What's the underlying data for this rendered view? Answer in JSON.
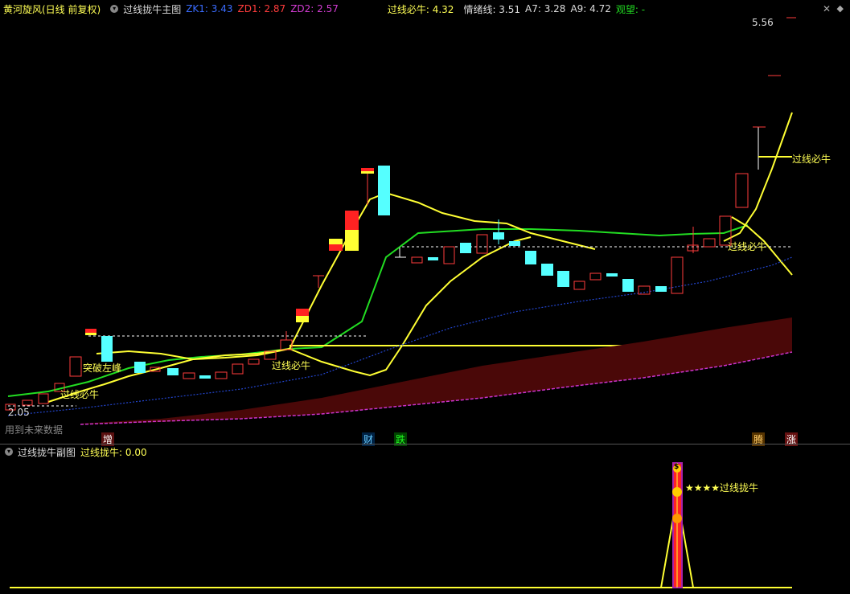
{
  "header": {
    "stock_name": "黄河旋风(日线 前复权)",
    "indicator_name": "过线拢牛主图",
    "zk1_label": "ZK1: 3.43",
    "zd1_label": "ZD1: 2.87",
    "zd2_label": "ZD2: 2.57",
    "guoxian_label": "过线必牛: 4.32",
    "qingxu_label": "情绪线: 3.51",
    "a7_label": "A7: 3.28",
    "a9_label": "A9: 4.72",
    "guanwang_label": "观望: -",
    "colors": {
      "zk1": "#3a6cff",
      "zd1": "#ff3c3c",
      "zd2": "#d23cd2",
      "yellow": "#ffff55",
      "green": "#22dd22",
      "white": "#dddddd"
    }
  },
  "main_chart": {
    "max_price_label": "5.56",
    "min_price_label": "2.05",
    "annotations": [
      "突破左峰",
      "过线必牛",
      "过线必牛",
      "过线必牛",
      "过线必牛"
    ],
    "future_label": "用到未来数据",
    "bottom_badges": [
      {
        "text": "增",
        "color": "#ffffff",
        "bg": "#5a1010"
      },
      {
        "text": "财",
        "color": "#66ccff",
        "bg": "#002244"
      },
      {
        "text": "跌",
        "color": "#22ff22",
        "bg": "#004400"
      },
      {
        "text": "腾",
        "color": "#ffcc66",
        "bg": "#553300"
      },
      {
        "text": "涨",
        "color": "#ffffff",
        "bg": "#661111"
      }
    ]
  },
  "sub_header": {
    "indicator_name": "过线拢牛副图",
    "value_label": "过线拢牛: 0.00"
  },
  "sub_chart": {
    "stars_label": "★★★★过线拢牛",
    "dollar_icon": "$"
  },
  "icons": {
    "close": "close-icon",
    "settings": "gear-icon",
    "dropdown": "chevron-down-icon"
  }
}
